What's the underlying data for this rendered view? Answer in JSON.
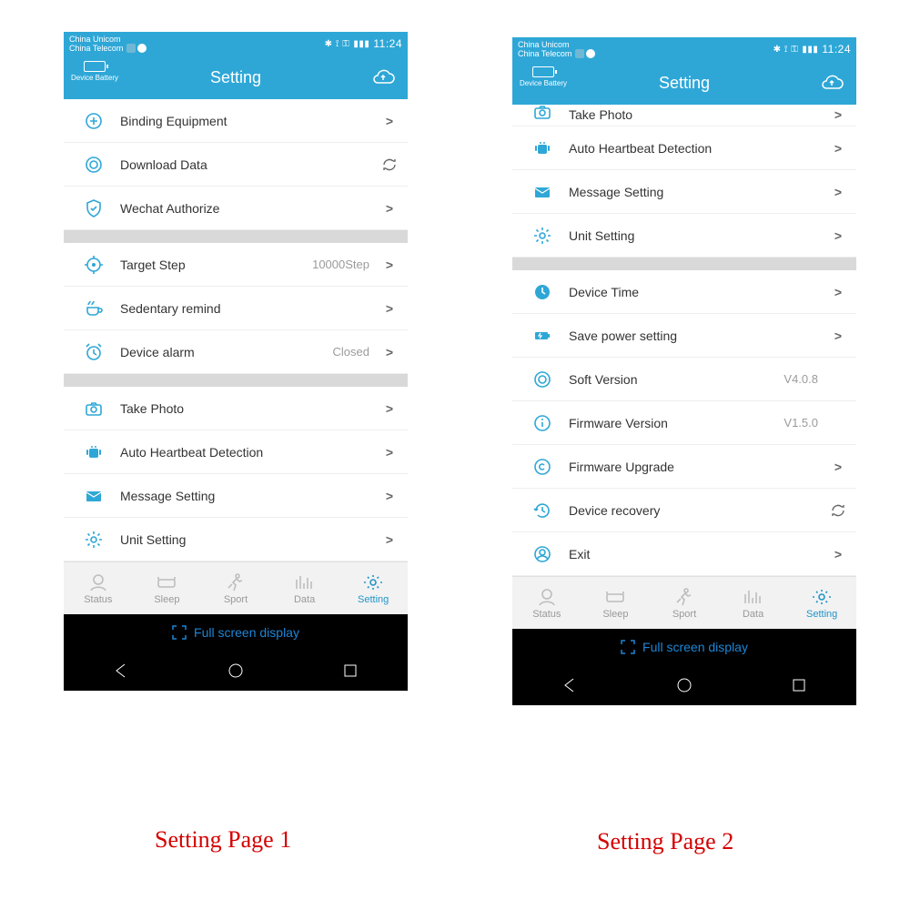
{
  "status": {
    "carrier1": "China Unicom",
    "carrier2": "China Telecom",
    "clock": "11:24"
  },
  "header": {
    "title": "Setting",
    "battery_label": "Device Battery"
  },
  "page1": {
    "groups": [
      [
        {
          "key": "binding",
          "label": "Binding Equipment",
          "icon": "circle-plus",
          "action": "chev"
        },
        {
          "key": "download",
          "label": "Download Data",
          "icon": "ring",
          "action": "refresh"
        },
        {
          "key": "wechat",
          "label": "Wechat Authorize",
          "icon": "shield",
          "action": "chev"
        }
      ],
      [
        {
          "key": "target",
          "label": "Target Step",
          "icon": "target",
          "value": "10000Step",
          "action": "chev"
        },
        {
          "key": "sedentary",
          "label": "Sedentary remind",
          "icon": "cup",
          "action": "chev"
        },
        {
          "key": "alarm",
          "label": "Device alarm",
          "icon": "clock-alarm",
          "value": "Closed",
          "action": "chev"
        }
      ],
      [
        {
          "key": "photo",
          "label": "Take Photo",
          "icon": "camera",
          "action": "chev"
        },
        {
          "key": "heartbeat",
          "label": "Auto Heartbeat Detection",
          "icon": "android",
          "action": "chev"
        },
        {
          "key": "message",
          "label": "Message Setting",
          "icon": "mail",
          "action": "chev"
        },
        {
          "key": "unit",
          "label": "Unit Setting",
          "icon": "gear",
          "action": "chev"
        }
      ]
    ]
  },
  "page2": {
    "partial_row": {
      "key": "photo2",
      "label": "Take Photo",
      "icon": "camera",
      "action": "chev"
    },
    "groups": [
      [
        {
          "key": "heartbeat2",
          "label": "Auto Heartbeat Detection",
          "icon": "android",
          "action": "chev"
        },
        {
          "key": "message2",
          "label": "Message Setting",
          "icon": "mail",
          "action": "chev"
        },
        {
          "key": "unit2",
          "label": "Unit Setting",
          "icon": "gear",
          "action": "chev"
        }
      ],
      [
        {
          "key": "devicetime",
          "label": "Device Time",
          "icon": "clock",
          "action": "chev"
        },
        {
          "key": "savepower",
          "label": "Save power setting",
          "icon": "battery-save",
          "action": "chev"
        },
        {
          "key": "softver",
          "label": "Soft Version",
          "icon": "circle-o",
          "value": "V4.0.8",
          "action": "none"
        },
        {
          "key": "fwver",
          "label": "Firmware Version",
          "icon": "info",
          "value": "V1.5.0",
          "action": "none"
        },
        {
          "key": "fwupgrade",
          "label": "Firmware Upgrade",
          "icon": "copyright",
          "action": "chev"
        },
        {
          "key": "recovery",
          "label": "Device recovery",
          "icon": "history",
          "action": "refresh"
        },
        {
          "key": "exit",
          "label": "Exit",
          "icon": "profile",
          "action": "chev"
        }
      ]
    ]
  },
  "tabs": [
    {
      "key": "status",
      "label": "Status"
    },
    {
      "key": "sleep",
      "label": "Sleep"
    },
    {
      "key": "sport",
      "label": "Sport"
    },
    {
      "key": "data",
      "label": "Data"
    },
    {
      "key": "setting",
      "label": "Setting",
      "active": true
    }
  ],
  "footer": {
    "full_screen": "Full screen display"
  },
  "captions": {
    "p1": "Setting Page 1",
    "p2": "Setting Page 2"
  },
  "colors": {
    "accent": "#2ea7d7",
    "link": "#1d86d6"
  }
}
